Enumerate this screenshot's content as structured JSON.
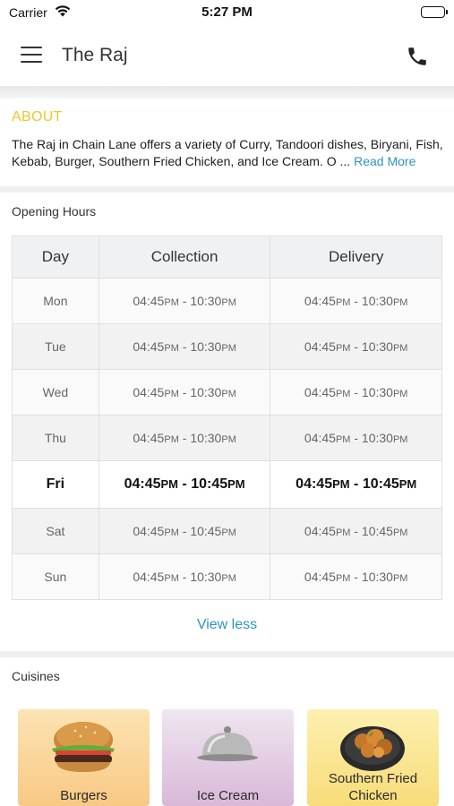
{
  "status_bar": {
    "carrier": "Carrier",
    "time": "5:27 PM"
  },
  "nav": {
    "title": "The Raj",
    "menu_icon": "hamburger-menu-icon",
    "call_icon": "phone-icon"
  },
  "about": {
    "heading": "ABOUT",
    "text": "The Raj in Chain Lane offers a variety of Curry, Tandoori dishes, Biryani, Fish, Kebab, Burger, Southern Fried Chicken, and Ice Cream. O ...",
    "read_more": "Read More"
  },
  "opening_hours": {
    "title": "Opening Hours",
    "headers": [
      "Day",
      "Collection",
      "Delivery"
    ],
    "rows": [
      {
        "day": "Mon",
        "collection_start": "04:45",
        "collection_end": "10:30",
        "delivery_start": "04:45",
        "delivery_end": "10:30"
      },
      {
        "day": "Tue",
        "collection_start": "04:45",
        "collection_end": "10:30",
        "delivery_start": "04:45",
        "delivery_end": "10:30"
      },
      {
        "day": "Wed",
        "collection_start": "04:45",
        "collection_end": "10:30",
        "delivery_start": "04:45",
        "delivery_end": "10:30"
      },
      {
        "day": "Thu",
        "collection_start": "04:45",
        "collection_end": "10:30",
        "delivery_start": "04:45",
        "delivery_end": "10:30"
      },
      {
        "day": "Fri",
        "collection_start": "04:45",
        "collection_end": "10:45",
        "delivery_start": "04:45",
        "delivery_end": "10:45"
      },
      {
        "day": "Sat",
        "collection_start": "04:45",
        "collection_end": "10:45",
        "delivery_start": "04:45",
        "delivery_end": "10:45"
      },
      {
        "day": "Sun",
        "collection_start": "04:45",
        "collection_end": "10:30",
        "delivery_start": "04:45",
        "delivery_end": "10:30"
      }
    ],
    "meridiem": "PM",
    "separator": " - ",
    "view_less": "View less"
  },
  "cuisines": {
    "title": "Cuisines",
    "items": [
      {
        "label": "Burgers",
        "icon": "burger-icon"
      },
      {
        "label": "Ice Cream",
        "icon": "cloche-icon"
      },
      {
        "label": "Southern Fried Chicken",
        "icon": "fried-chicken-icon"
      }
    ]
  },
  "colors": {
    "accent_link": "#2d93c4",
    "about_heading": "#f0c62f"
  }
}
